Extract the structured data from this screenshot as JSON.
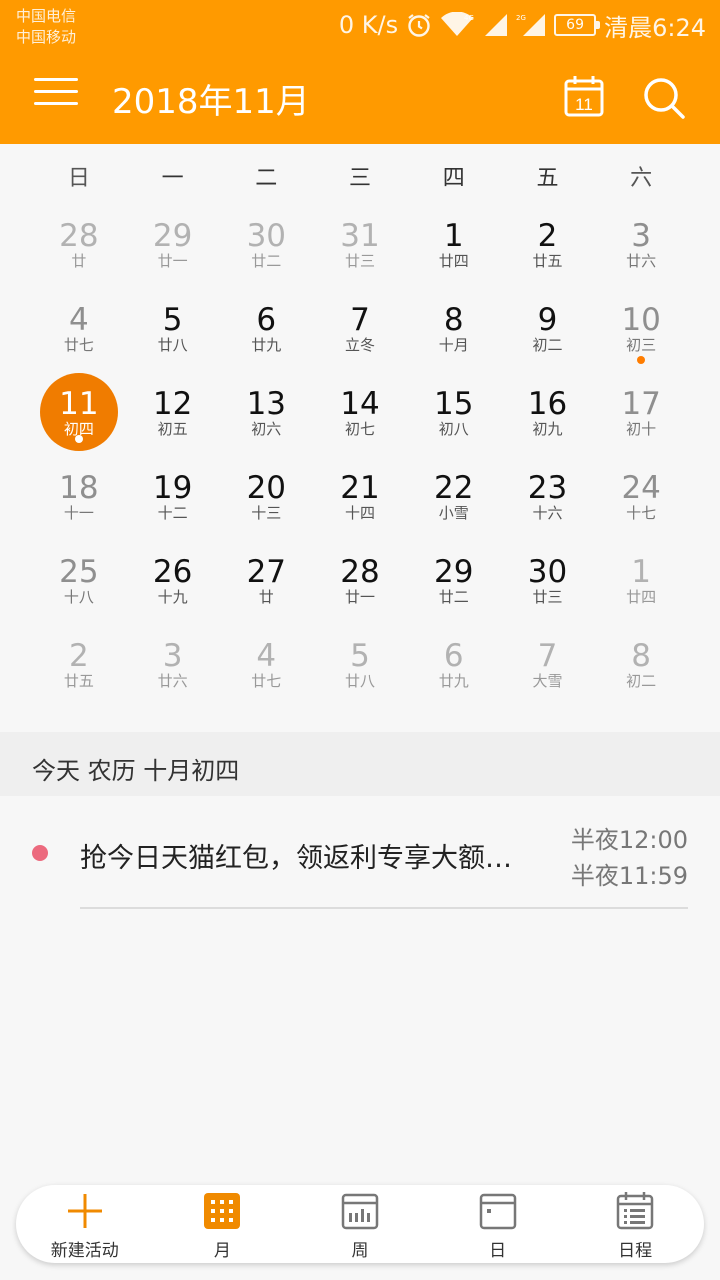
{
  "status_bar": {
    "carrier1": "中国电信",
    "carrier2": "中国移动",
    "speed": "0 K/s",
    "net1": "4G",
    "net2": "2G",
    "battery": "69",
    "time": "清晨6:24"
  },
  "app_bar": {
    "title": "2018年11月",
    "today_day": "11",
    "accent_color": "#ff9a00"
  },
  "weekdays": [
    "日",
    "一",
    "二",
    "三",
    "四",
    "五",
    "六"
  ],
  "weeks": [
    [
      {
        "d": "28",
        "l": "廿",
        "m": "prev"
      },
      {
        "d": "29",
        "l": "廿一",
        "m": "prev"
      },
      {
        "d": "30",
        "l": "廿二",
        "m": "prev"
      },
      {
        "d": "31",
        "l": "廿三",
        "m": "prev"
      },
      {
        "d": "1",
        "l": "廿四",
        "m": "cur"
      },
      {
        "d": "2",
        "l": "廿五",
        "m": "cur"
      },
      {
        "d": "3",
        "l": "廿六",
        "m": "cur"
      }
    ],
    [
      {
        "d": "4",
        "l": "廿七",
        "m": "cur"
      },
      {
        "d": "5",
        "l": "廿八",
        "m": "cur"
      },
      {
        "d": "6",
        "l": "廿九",
        "m": "cur"
      },
      {
        "d": "7",
        "l": "立冬",
        "m": "cur"
      },
      {
        "d": "8",
        "l": "十月",
        "m": "cur"
      },
      {
        "d": "9",
        "l": "初二",
        "m": "cur"
      },
      {
        "d": "10",
        "l": "初三",
        "m": "cur",
        "dot": true
      }
    ],
    [
      {
        "d": "11",
        "l": "初四",
        "m": "cur",
        "today": true,
        "dot": true
      },
      {
        "d": "12",
        "l": "初五",
        "m": "cur"
      },
      {
        "d": "13",
        "l": "初六",
        "m": "cur"
      },
      {
        "d": "14",
        "l": "初七",
        "m": "cur"
      },
      {
        "d": "15",
        "l": "初八",
        "m": "cur"
      },
      {
        "d": "16",
        "l": "初九",
        "m": "cur"
      },
      {
        "d": "17",
        "l": "初十",
        "m": "cur"
      }
    ],
    [
      {
        "d": "18",
        "l": "十一",
        "m": "cur"
      },
      {
        "d": "19",
        "l": "十二",
        "m": "cur"
      },
      {
        "d": "20",
        "l": "十三",
        "m": "cur"
      },
      {
        "d": "21",
        "l": "十四",
        "m": "cur"
      },
      {
        "d": "22",
        "l": "小雪",
        "m": "cur"
      },
      {
        "d": "23",
        "l": "十六",
        "m": "cur"
      },
      {
        "d": "24",
        "l": "十七",
        "m": "cur"
      }
    ],
    [
      {
        "d": "25",
        "l": "十八",
        "m": "cur"
      },
      {
        "d": "26",
        "l": "十九",
        "m": "cur"
      },
      {
        "d": "27",
        "l": "廿",
        "m": "cur"
      },
      {
        "d": "28",
        "l": "廿一",
        "m": "cur"
      },
      {
        "d": "29",
        "l": "廿二",
        "m": "cur"
      },
      {
        "d": "30",
        "l": "廿三",
        "m": "cur"
      },
      {
        "d": "1",
        "l": "廿四",
        "m": "next"
      }
    ],
    [
      {
        "d": "2",
        "l": "廿五",
        "m": "next"
      },
      {
        "d": "3",
        "l": "廿六",
        "m": "next"
      },
      {
        "d": "4",
        "l": "廿七",
        "m": "next"
      },
      {
        "d": "5",
        "l": "廿八",
        "m": "next"
      },
      {
        "d": "6",
        "l": "廿九",
        "m": "next"
      },
      {
        "d": "7",
        "l": "大雪",
        "m": "next"
      },
      {
        "d": "8",
        "l": "初二",
        "m": "next"
      }
    ]
  ],
  "today_section": {
    "header": "今天  农历 十月初四",
    "event": {
      "title": "抢今日天猫红包，领返利专享大额…",
      "start": "半夜12:00",
      "end": "半夜11:59",
      "color": "#ec6a7e"
    }
  },
  "bottom_nav": {
    "items": [
      {
        "label": "新建活动",
        "icon": "plus-icon"
      },
      {
        "label": "月",
        "icon": "month-grid-icon"
      },
      {
        "label": "周",
        "icon": "week-icon"
      },
      {
        "label": "日",
        "icon": "day-icon"
      },
      {
        "label": "日程",
        "icon": "agenda-icon"
      }
    ]
  }
}
